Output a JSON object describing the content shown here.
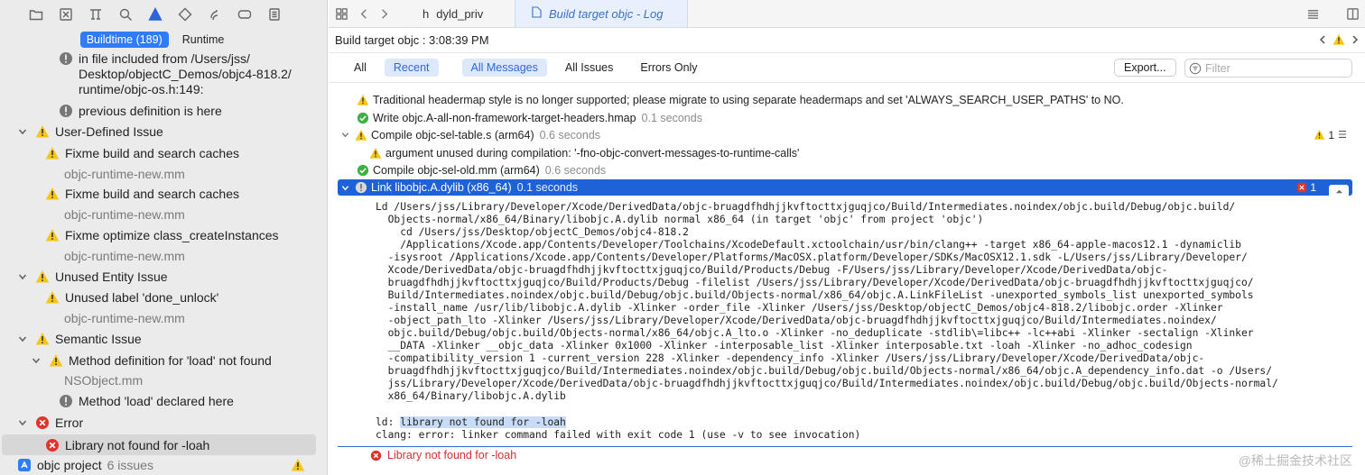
{
  "navigator": {
    "scopes": [
      "Buildtime (189)",
      "Runtime"
    ],
    "rows": [
      {
        "kind": "note",
        "text": "in file included from /Users/jss/\nDesktop/objectC_Demos/objc4-818.2/\nruntime/objc-os.h:149:"
      },
      {
        "kind": "note",
        "text": "previous definition is here"
      },
      {
        "kind": "group",
        "text": "User-Defined Issue"
      },
      {
        "kind": "warn",
        "text": "Fixme build and search caches"
      },
      {
        "kind": "file",
        "text": "objc-runtime-new.mm"
      },
      {
        "kind": "warn",
        "text": "Fixme build and search caches"
      },
      {
        "kind": "file",
        "text": "objc-runtime-new.mm"
      },
      {
        "kind": "warn",
        "text": "Fixme optimize class_createInstances"
      },
      {
        "kind": "file",
        "text": "objc-runtime-new.mm"
      },
      {
        "kind": "group",
        "text": "Unused Entity Issue"
      },
      {
        "kind": "warn",
        "text": "Unused label 'done_unlock'"
      },
      {
        "kind": "file",
        "text": "objc-runtime-new.mm"
      },
      {
        "kind": "group",
        "text": "Semantic Issue"
      },
      {
        "kind": "warn",
        "text": "Method definition for 'load' not found"
      },
      {
        "kind": "file",
        "text": "NSObject.mm"
      },
      {
        "kind": "note",
        "text": "Method 'load' declared here"
      },
      {
        "kind": "group-error",
        "text": "Error"
      },
      {
        "kind": "error",
        "text": "Library not found for -loah"
      }
    ],
    "project": {
      "name": "objc project",
      "count": "6 issues"
    }
  },
  "tabs": [
    {
      "label": "dyld_priv",
      "glyph": "h"
    },
    {
      "label": "Build target objc - Log",
      "glyph": "📄"
    }
  ],
  "crumb": "Build target objc : 3:08:39 PM",
  "filters": {
    "left": [
      "All",
      "Recent"
    ],
    "right": [
      "All Messages",
      "All Issues",
      "Errors Only"
    ],
    "export": "Export...",
    "filter_placeholder": "Filter"
  },
  "log_rows": [
    {
      "icon": "warn",
      "text": "Traditional headermap style is no longer supported; please migrate to using separate headermaps and set 'ALWAYS_SEARCH_USER_PATHS' to NO.",
      "dur": ""
    },
    {
      "icon": "ok",
      "text": "Write objc.A-all-non-framework-target-headers.hmap",
      "dur": "0.1 seconds"
    },
    {
      "icon": "disc",
      "text": "Compile objc-sel-table.s (arm64)",
      "dur": "0.6 seconds",
      "badge": "1"
    },
    {
      "icon": "warn",
      "text": "argument unused during compilation: '-fno-objc-convert-messages-to-runtime-calls'",
      "dur": ""
    },
    {
      "icon": "ok",
      "text": "Compile objc-sel-old.mm (arm64)",
      "dur": "0.6 seconds"
    },
    {
      "icon": "disc",
      "text": "Link libobjc.A.dylib (x86_64)",
      "dur": "0.1 seconds",
      "badge": "1"
    }
  ],
  "transcript": "Ld /Users/jss/Library/Developer/Xcode/DerivedData/objc-bruagdfhdhjjkvftocttxjguqjco/Build/Intermediates.noindex/objc.build/Debug/objc.build/\n  Objects-normal/x86_64/Binary/libobjc.A.dylib normal x86_64 (in target 'objc' from project 'objc')\n    cd /Users/jss/Desktop/objectC_Demos/objc4-818.2\n    /Applications/Xcode.app/Contents/Developer/Toolchains/XcodeDefault.xctoolchain/usr/bin/clang++ -target x86_64-apple-macos12.1 -dynamiclib\n  -isysroot /Applications/Xcode.app/Contents/Developer/Platforms/MacOSX.platform/Developer/SDKs/MacOSX12.1.sdk -L/Users/jss/Library/Developer/\n  Xcode/DerivedData/objc-bruagdfhdhjjkvftocttxjguqjco/Build/Products/Debug -F/Users/jss/Library/Developer/Xcode/DerivedData/objc-\n  bruagdfhdhjjkvftocttxjguqjco/Build/Products/Debug -filelist /Users/jss/Library/Developer/Xcode/DerivedData/objc-bruagdfhdhjjkvftocttxjguqjco/\n  Build/Intermediates.noindex/objc.build/Debug/objc.build/Objects-normal/x86_64/objc.A.LinkFileList -unexported_symbols_list unexported_symbols\n  -install_name /usr/lib/libobjc.A.dylib -Xlinker -order_file -Xlinker /Users/jss/Desktop/objectC_Demos/objc4-818.2/libobjc.order -Xlinker\n  -object_path_lto -Xlinker /Users/jss/Library/Developer/Xcode/DerivedData/objc-bruagdfhdhjjkvftocttxjguqjco/Build/Intermediates.noindex/\n  objc.build/Debug/objc.build/Objects-normal/x86_64/objc.A_lto.o -Xlinker -no_deduplicate -stdlib\\=libc++ -lc++abi -Xlinker -sectalign -Xlinker\n  __DATA -Xlinker __objc_data -Xlinker 0x1000 -Xlinker -interposable_list -Xlinker interposable.txt -loah -Xlinker -no_adhoc_codesign\n  -compatibility_version 1 -current_version 228 -Xlinker -dependency_info -Xlinker /Users/jss/Library/Developer/Xcode/DerivedData/objc-\n  bruagdfhdhjjkvftocttxjguqjco/Build/Intermediates.noindex/objc.build/Debug/objc.build/Objects-normal/x86_64/objc.A_dependency_info.dat -o /Users/\n  jss/Library/Developer/Xcode/DerivedData/objc-bruagdfhdhjjkvftocttxjguqjco/Build/Intermediates.noindex/objc.build/Debug/objc.build/Objects-normal/\n  x86_64/Binary/libobjc.A.dylib",
  "error_output": {
    "prefix": "ld: ",
    "highlight": "library not found for -loah",
    "line2": "clang: error: linker command failed with exit code 1 (use -v to see invocation)"
  },
  "error_summary": "Library not found for -loah",
  "watermark": "@稀土掘金技术社区",
  "colors": {
    "accent": "#2f7cf6",
    "warning": "#f5c518",
    "error": "#e0332b",
    "ok": "#3cb043"
  }
}
